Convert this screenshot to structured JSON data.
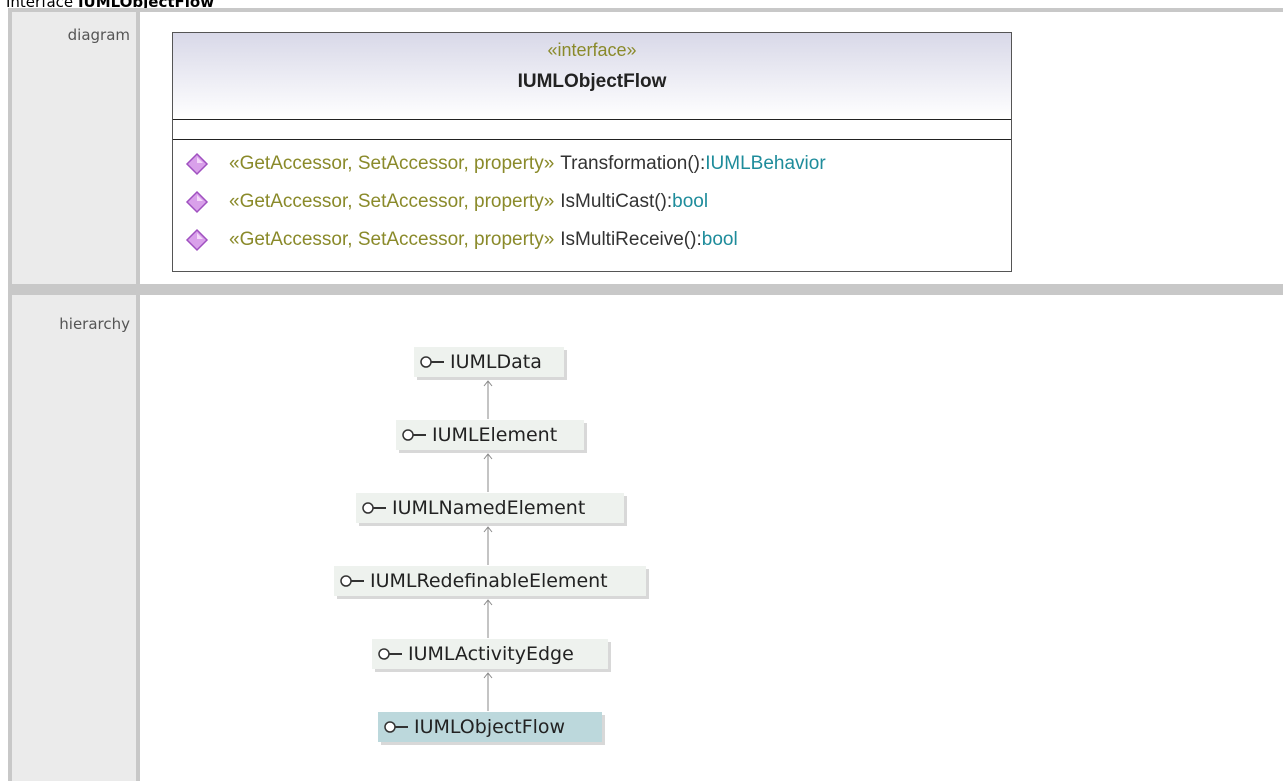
{
  "page": {
    "title_prefix": "Interface ",
    "title_name": "IUMLObjectFlow"
  },
  "rows": {
    "diagram_label": "diagram",
    "hierarchy_label": "hierarchy"
  },
  "diagram": {
    "stereotype": "«interface»",
    "name": "IUMLObjectFlow",
    "operations": [
      {
        "stereotype": "«GetAccessor, SetAccessor, property»",
        "name": "Transformation():",
        "type": "IUMLBehavior"
      },
      {
        "stereotype": "«GetAccessor, SetAccessor, property»",
        "name": "IsMultiCast():",
        "type": "bool"
      },
      {
        "stereotype": "«GetAccessor, SetAccessor, property»",
        "name": "IsMultiReceive():",
        "type": "bool"
      }
    ],
    "operation_icon": "purple-diamond-icon",
    "colors": {
      "stereotype": "#8a8a2a",
      "type": "#1e8c9b",
      "operation_icon": "#c070d8"
    }
  },
  "hierarchy": {
    "nodes": [
      {
        "name": "IUMLData"
      },
      {
        "name": "IUMLElement"
      },
      {
        "name": "IUMLNamedElement"
      },
      {
        "name": "IUMLRedefinableElement"
      },
      {
        "name": "IUMLActivityEdge"
      },
      {
        "name": "IUMLObjectFlow",
        "current": true
      }
    ],
    "node_icon": "interface-lollipop-icon",
    "colors": {
      "node_bg": "#eef2ee",
      "current_bg": "#bcd8dc"
    }
  }
}
